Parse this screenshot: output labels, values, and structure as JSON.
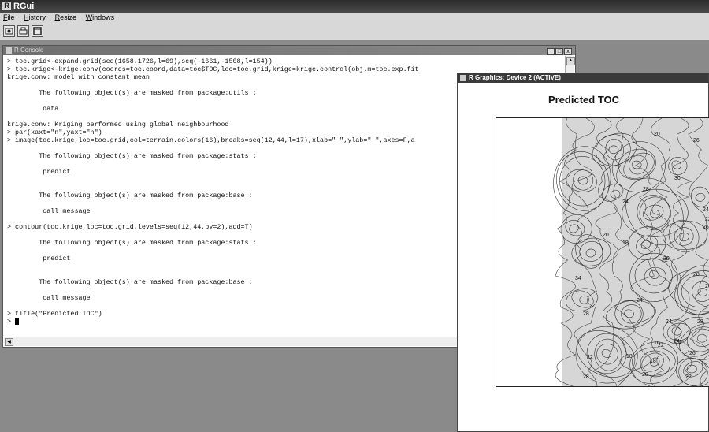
{
  "app": {
    "title": "RGui",
    "logo": "R"
  },
  "menu": [
    {
      "first": "F",
      "rest": "ile"
    },
    {
      "first": "H",
      "rest": "istory"
    },
    {
      "first": "R",
      "rest": "esize"
    },
    {
      "first": "W",
      "rest": "indows"
    }
  ],
  "toolbar": {
    "icons": [
      "save-workspace-icon",
      "print-icon",
      "window-icon"
    ]
  },
  "console": {
    "title": "R Console",
    "lines": [
      "> toc.grid<-expand.grid(seq(1658,1726,l=69),seq(-1661,-1508,l=154))",
      "> toc.krige<-krige.conv(coords=toc.coord,data=toc$TOC,loc=toc.grid,krige=krige.control(obj.m=toc.exp.fit",
      "krige.conv: model with constant mean",
      "",
      "        The following object(s) are masked from package:utils :",
      "",
      "         data",
      "",
      "krige.conv: Kriging performed using global neighbourhood",
      "> par(xaxt=\"n\",yaxt=\"n\")",
      "> image(toc.krige,loc=toc.grid,col=terrain.colors(16),breaks=seq(12,44,l=17),xlab=\" \",ylab=\" \",axes=F,a",
      "",
      "        The following object(s) are masked from package:stats :",
      "",
      "         predict",
      "",
      "",
      "        The following object(s) are masked from package:base :",
      "",
      "         call message",
      "",
      "> contour(toc.krige,loc=toc.grid,levels=seq(12,44,by=2),add=T)",
      "",
      "        The following object(s) are masked from package:stats :",
      "",
      "         predict",
      "",
      "",
      "        The following object(s) are masked from package:base :",
      "",
      "         call message",
      "",
      "> title(\"Predicted TOC\")",
      "> "
    ]
  },
  "graphics": {
    "title": "R Graphics: Device 2 (ACTIVE)",
    "plot_title": "Predicted TOC",
    "contour_labels": [
      "20",
      "26",
      "30",
      "24",
      "28",
      "22",
      "26",
      "24",
      "30",
      "28",
      "20",
      "18",
      "26",
      "22",
      "24",
      "34",
      "24",
      "22",
      "26",
      "28",
      "22",
      "18",
      "28",
      "24",
      "16",
      "22",
      "20",
      "18",
      "22",
      "28"
    ]
  }
}
